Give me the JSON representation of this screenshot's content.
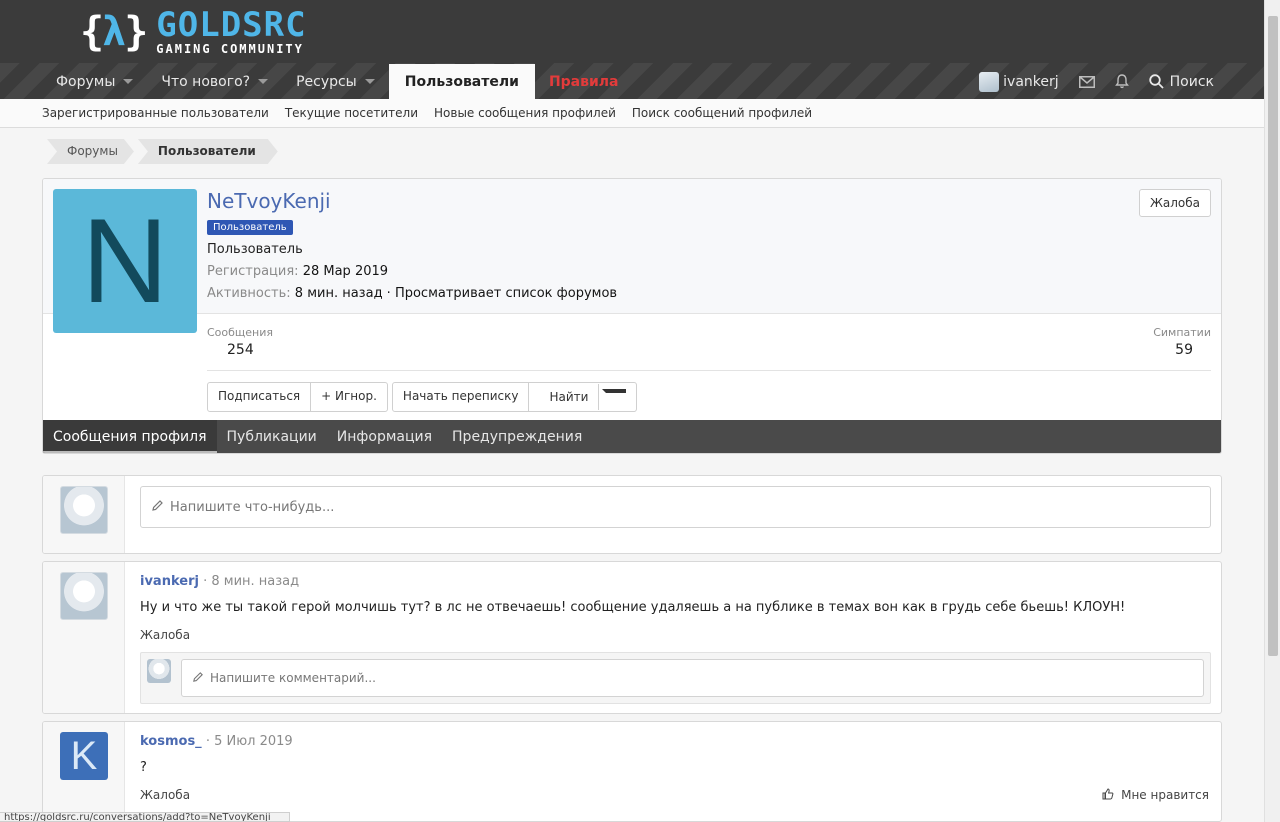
{
  "logo": {
    "brace_open": "{",
    "lambda": "λ",
    "brace_close": "}",
    "main": "GOLDSRC",
    "sub": "GAMING COMMUNITY"
  },
  "nav": {
    "items": [
      {
        "label": "Форумы",
        "has_caret": true
      },
      {
        "label": "Что нового?",
        "has_caret": true
      },
      {
        "label": "Ресурсы",
        "has_caret": true
      },
      {
        "label": "Пользователи",
        "active": true
      },
      {
        "label": "Правила",
        "highlight": "#e33b3b"
      }
    ],
    "account_name": "ivankerj",
    "search_label": "Поиск"
  },
  "subnav": {
    "items": [
      "Зарегистрированные пользователи",
      "Текущие посетители",
      "Новые сообщения профилей",
      "Поиск сообщений профилей"
    ]
  },
  "breadcrumb": [
    "Форумы",
    "Пользователи"
  ],
  "profile": {
    "avatar_letter": "N",
    "username": "NeTvoyKenji",
    "badge": "Пользователь",
    "title": "Пользователь",
    "reg_label": "Регистрация:",
    "reg_date": "28 Мар 2019",
    "activity_label": "Активность:",
    "activity_value": "8 мин. назад · Просматривает список форумов",
    "report": "Жалоба",
    "stats": {
      "messages_label": "Сообщения",
      "messages_value": "254",
      "likes_label": "Симпатии",
      "likes_value": "59"
    },
    "buttons": {
      "follow": "Подписаться",
      "ignore": "+ Игнор.",
      "start_conversation": "Начать переписку",
      "find": "Найти"
    },
    "tabs": [
      "Сообщения профиля",
      "Публикации",
      "Информация",
      "Предупреждения"
    ]
  },
  "status_box": {
    "placeholder": "Напишите что-нибудь..."
  },
  "posts": [
    {
      "author": "ivankerj",
      "time": "· 8 мин. назад",
      "body": "Ну и что же ты такой герой молчишь тут? в лс не отвечаешь! сообщение удаляешь а на публике в темах вон как в грудь себе бьешь! КЛОУН!",
      "report": "Жалоба",
      "comment_placeholder": "Напишите комментарий..."
    },
    {
      "author": "kosmos_",
      "avatar_letter": "K",
      "time": "· 5 Июл 2019",
      "body": "?",
      "report": "Жалоба",
      "like": "Мне нравится"
    }
  ],
  "statusbar": "https://goldsrc.ru/conversations/add?to=NeTvoyKenji",
  "colors": {
    "header_bg": "#3b3b3b",
    "accent": "#4b6ab1",
    "logo_blue": "#4fb6e8",
    "rules_red": "#e33b3b",
    "badge": "#2f57b4"
  }
}
